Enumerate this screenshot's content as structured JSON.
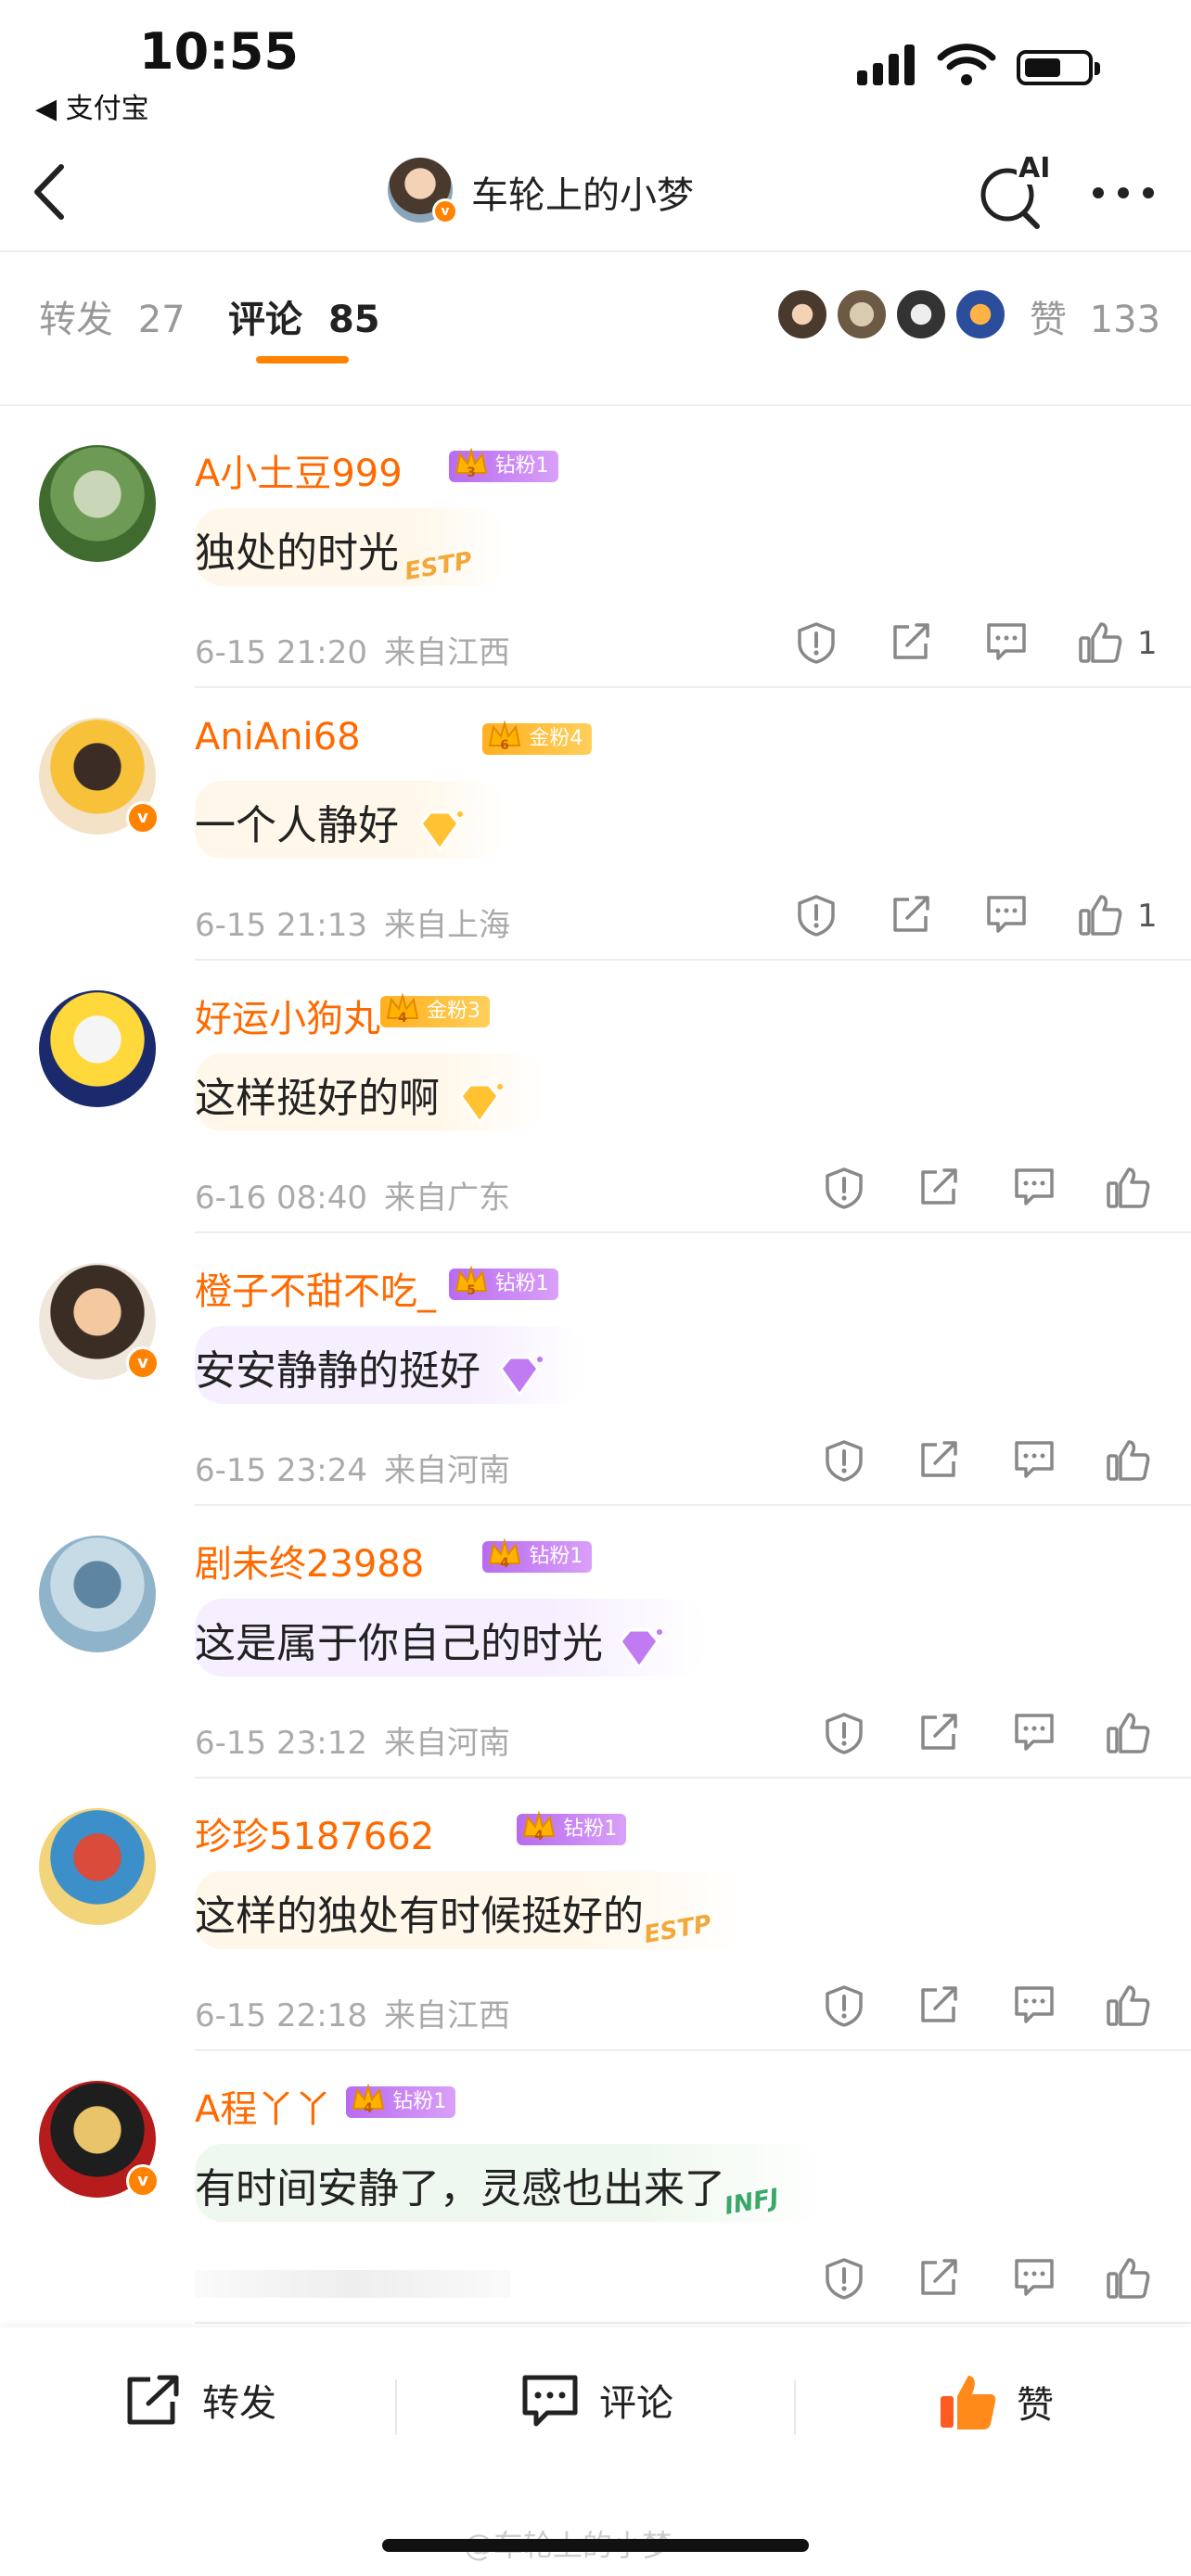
{
  "status": {
    "time": "10:55",
    "back_app": "◀ 支付宝"
  },
  "nav": {
    "title": "车轮上的小梦",
    "ai_label": "AI"
  },
  "tabs": [
    {
      "label": "转发",
      "count": "27"
    },
    {
      "label": "评论",
      "count": "85"
    }
  ],
  "likes": {
    "label": "赞",
    "count": "133"
  },
  "comments": [
    {
      "name": "A小土豆999",
      "fan_level": "3",
      "fan_label": "钻粉1",
      "fan_color": "#b86bf0",
      "text": "独处的时光",
      "deco": "ESTP",
      "time": "6-15 21:20",
      "location": "来自江西",
      "like_count": "1",
      "verified": false,
      "avatar_colors": [
        "#3f6b2f",
        "#6d9b55",
        "#c9d6b8"
      ]
    },
    {
      "name": "AniAni68",
      "fan_level": "6",
      "fan_label": "金粉4",
      "fan_color": "#ffb020",
      "text": "一个人静好",
      "deco": "",
      "time": "6-15 21:13",
      "location": "来自上海",
      "like_count": "1",
      "verified": true,
      "avatar_colors": [
        "#f3e2c6",
        "#f7c23a",
        "#3b2d25"
      ]
    },
    {
      "name": "好运小狗丸",
      "fan_level": "4",
      "fan_label": "金粉3",
      "fan_color": "#ffb020",
      "text": "这样挺好的啊",
      "deco": "",
      "time": "6-16 08:40",
      "location": "来自广东",
      "like_count": "",
      "verified": false,
      "avatar_colors": [
        "#1a2a6c",
        "#ffd93b",
        "#f5f5f5"
      ]
    },
    {
      "name": "橙子不甜不吃_",
      "fan_level": "5",
      "fan_label": "钻粉1",
      "fan_color": "#b86bf0",
      "text": "安安静静的挺好",
      "deco": "",
      "time": "6-15 23:24",
      "location": "来自河南",
      "like_count": "",
      "verified": true,
      "avatar_colors": [
        "#efe7dc",
        "#3a2d24",
        "#f4c9a0"
      ]
    },
    {
      "name": "剧未终23988",
      "fan_level": "4",
      "fan_label": "钻粉1",
      "fan_color": "#b86bf0",
      "text": "这是属于你自己的时光",
      "deco": "",
      "time": "6-15 23:12",
      "location": "来自河南",
      "like_count": "",
      "verified": false,
      "avatar_colors": [
        "#8fb3c9",
        "#c7dbe6",
        "#5e86a3"
      ]
    },
    {
      "name": "珍珍5187662",
      "fan_level": "4",
      "fan_label": "钻粉1",
      "fan_color": "#b86bf0",
      "text": "这样的独处有时候挺好的",
      "deco": "ESTP",
      "time": "6-15 22:18",
      "location": "来自江西",
      "like_count": "",
      "verified": false,
      "avatar_colors": [
        "#f2d47a",
        "#3d8fc9",
        "#d94b3a"
      ]
    },
    {
      "name": "A程丫丫",
      "fan_level": "4",
      "fan_label": "钻粉1",
      "fan_color": "#b86bf0",
      "text": "有时间安静了，灵感也出来了",
      "deco": "INFJ",
      "time": "",
      "location": "",
      "like_count": "",
      "verified": true,
      "avatar_colors": [
        "#b71c1c",
        "#1e1e1e",
        "#e9c46a"
      ]
    }
  ],
  "bottom": {
    "repost": "转发",
    "comment": "评论",
    "like": "赞"
  },
  "watermark": "@车轮上的小梦",
  "colors": {
    "accent": "#ff8200",
    "name": "#ff6a00"
  }
}
